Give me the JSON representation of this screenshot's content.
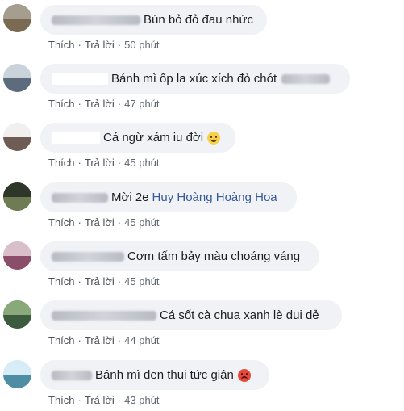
{
  "comments": [
    {
      "text": "Bún bỏ đỏ đau nhức",
      "like_label": "Thích",
      "reply_label": "Trả lời",
      "time": "50 phút",
      "avatar_colors": [
        "#bfb9ad",
        "#7a6a52"
      ]
    },
    {
      "text": "Bánh mì ốp la xúc xích đỏ chót",
      "like_label": "Thích",
      "reply_label": "Trả lời",
      "time": "47 phút",
      "avatar_colors": [
        "#dfe6ea",
        "#5d6c7c"
      ]
    },
    {
      "text": "Cá ngừ xám iu đời",
      "emoji": "smiling-face-emoji",
      "like_label": "Thích",
      "reply_label": "Trả lời",
      "time": "45 phút",
      "avatar_colors": [
        "#e9e6e3",
        "#6e5c55"
      ]
    },
    {
      "text": "Mời 2e",
      "tag": "Huy Hoàng Hoàng Hoa",
      "like_label": "Thích",
      "reply_label": "Trả lời",
      "time": "45 phút",
      "avatar_colors": [
        "#3f4a36",
        "#6d7c52"
      ]
    },
    {
      "text": "Cơm tấm bảy màu choáng váng",
      "like_label": "Thích",
      "reply_label": "Trả lời",
      "time": "45 phút",
      "avatar_colors": [
        "#c8a7b7",
        "#8a4d6a"
      ]
    },
    {
      "text": "Cá sốt cà chua xanh lè dui dẻ",
      "like_label": "Thích",
      "reply_label": "Trả lời",
      "time": "44 phút",
      "avatar_colors": [
        "#6f8f64",
        "#3c5b3e"
      ]
    },
    {
      "text": "Bánh mì đen thui tức giận",
      "emoji": "angry-face-emoji",
      "like_label": "Thích",
      "reply_label": "Trả lời",
      "time": "43 phút",
      "avatar_colors": [
        "#bfe0ef",
        "#4f8da5"
      ]
    }
  ],
  "colors": {
    "bubble": "#f0f2f5",
    "action_text": "#4b4f56",
    "link": "#385898"
  }
}
